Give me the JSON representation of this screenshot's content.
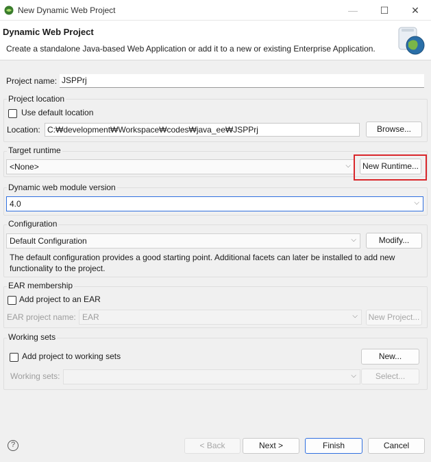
{
  "window": {
    "title": "New Dynamic Web Project",
    "minimize_glyph": "—",
    "maximize_glyph": "☐",
    "close_glyph": "✕"
  },
  "header": {
    "title": "Dynamic Web Project",
    "description": "Create a standalone Java-based Web Application or add it to a new or existing Enterprise Application."
  },
  "project_name": {
    "label": "Project name:",
    "value": "JSPPrj"
  },
  "project_location": {
    "legend": "Project location",
    "use_default_label": "Use default location",
    "use_default_checked": false,
    "location_label": "Location:",
    "location_value": "C:₩development₩Workspace₩codes₩java_ee₩JSPPrj",
    "browse_label": "Browse..."
  },
  "target_runtime": {
    "legend": "Target runtime",
    "selected": "<None>",
    "new_runtime_label": "New Runtime..."
  },
  "web_module": {
    "legend": "Dynamic web module version",
    "selected": "4.0"
  },
  "configuration": {
    "legend": "Configuration",
    "selected": "Default Configuration",
    "modify_label": "Modify...",
    "description": "The default configuration provides a good starting point. Additional facets can later be installed to add new functionality to the project."
  },
  "ear": {
    "legend": "EAR membership",
    "add_label": "Add project to an EAR",
    "add_checked": false,
    "name_label": "EAR project name:",
    "name_value": "EAR",
    "new_project_label": "New Project..."
  },
  "working_sets": {
    "legend": "Working sets",
    "add_label": "Add project to working sets",
    "add_checked": false,
    "new_label": "New...",
    "sets_label": "Working sets:",
    "select_label": "Select..."
  },
  "footer": {
    "help_glyph": "?",
    "back_label": "< Back",
    "next_label": "Next >",
    "finish_label": "Finish",
    "cancel_label": "Cancel"
  },
  "colors": {
    "highlight_box": "#d9262a",
    "focus_border": "#2f6fdf",
    "dialog_background": "#f0f0f0"
  },
  "icons": {
    "app_icon": "eclipse-icon",
    "banner_icon": "web-project-globe-icon",
    "help_icon": "help-icon",
    "chevron": "chevron-down-icon"
  }
}
